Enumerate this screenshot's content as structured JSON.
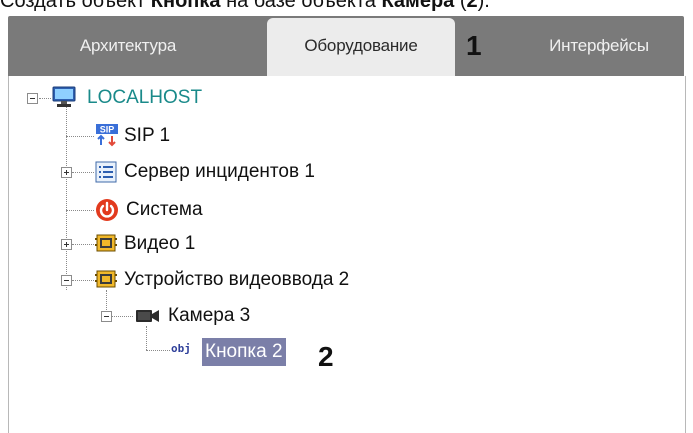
{
  "caption": {
    "prefix": "Создать объект ",
    "bold1": "Кнопка",
    "middle": " на базе объекта ",
    "bold2": "Камера",
    "open": " (",
    "num": "2",
    "close": ")."
  },
  "tabs": [
    {
      "label": "Архитектура",
      "active": false
    },
    {
      "label": "Оборудование",
      "active": true
    },
    {
      "label": "Интерфейсы",
      "active": false
    }
  ],
  "markers": {
    "tabs": "1",
    "selected": "2"
  },
  "tree": {
    "root": "LOCALHOST",
    "sip": "SIP 1",
    "incident_server": "Сервер инцидентов 1",
    "system": "Система",
    "video": "Видео 1",
    "capture_device": "Устройство видеоввода 2",
    "camera": "Камера 3",
    "button": "Кнопка 2",
    "obj_icon_text": "obj",
    "sip_icon_text": "SIP"
  },
  "colors": {
    "tabbar": "#7a7a7a",
    "active_tab": "#ececec",
    "selection": "#7b7fa8",
    "root_text": "#1a8a8a"
  }
}
